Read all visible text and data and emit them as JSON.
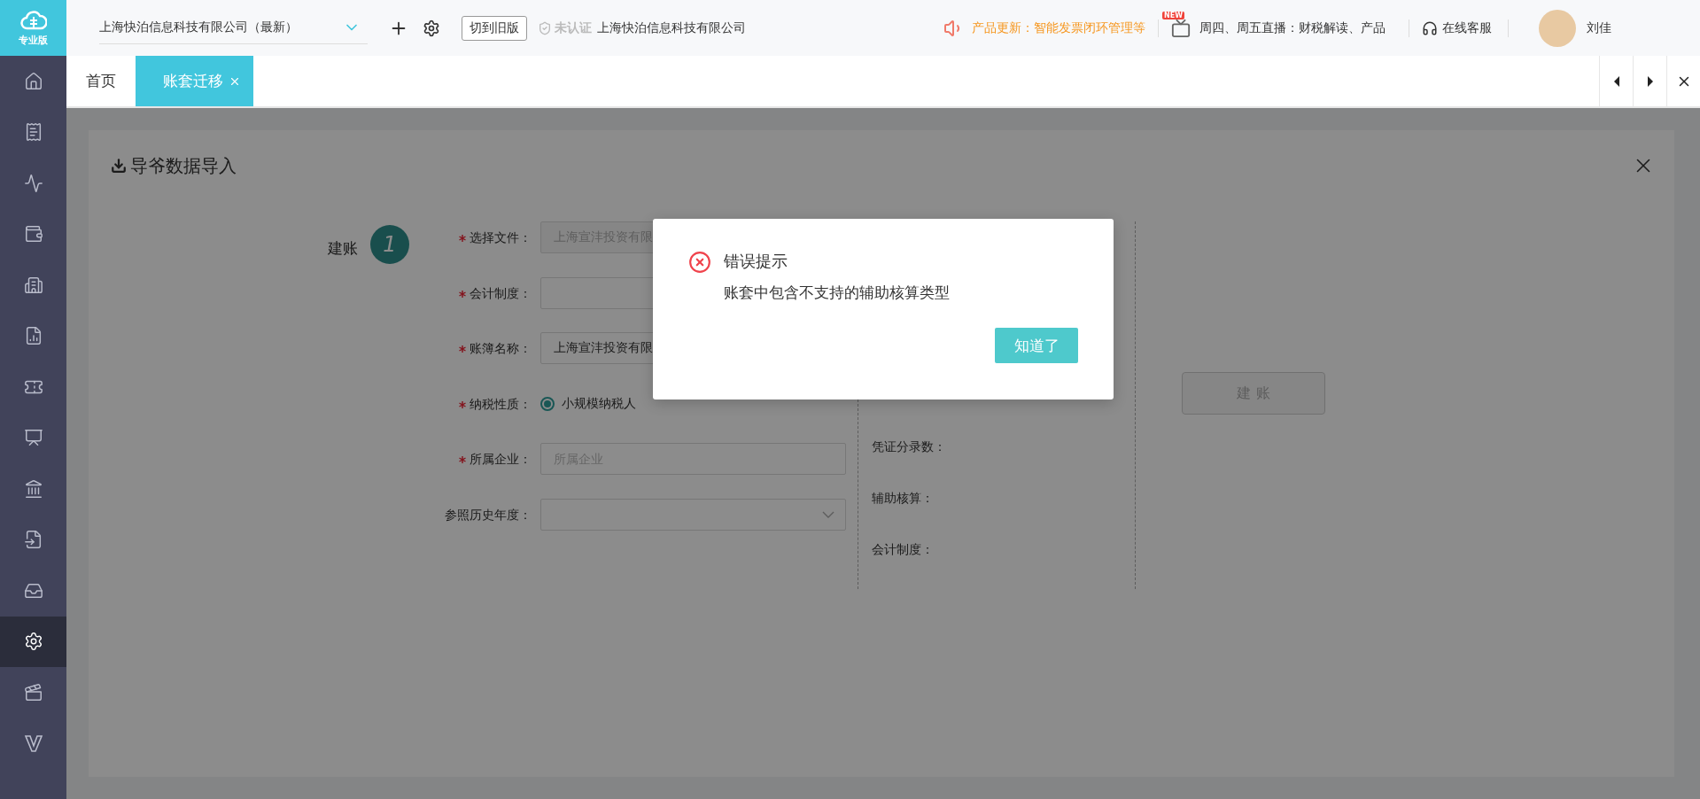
{
  "sidebar": {
    "logo_label": "专业版",
    "items": [
      {
        "selected": false
      },
      {
        "selected": false
      },
      {
        "selected": false
      },
      {
        "selected": false
      },
      {
        "selected": false
      },
      {
        "selected": false
      },
      {
        "selected": false
      },
      {
        "selected": false
      },
      {
        "selected": false
      },
      {
        "selected": false
      },
      {
        "selected": false
      },
      {
        "selected": true
      },
      {
        "selected": false
      },
      {
        "selected": false
      }
    ]
  },
  "header": {
    "company": "上海快泊信息科技有限公司（最新）",
    "switch_button": "切到旧版",
    "verify_status": "未认证",
    "verified_company": "上海快泊信息科技有限公司",
    "notice": "产品更新：智能发票闭环管理等",
    "live_badge": "NEW",
    "live_text": "周四、周五直播：财税解读、产品",
    "support": "在线客服",
    "user": "刘佳"
  },
  "tabs": [
    {
      "label": "首页",
      "selected": false,
      "closable": false
    },
    {
      "label": "账套迁移",
      "selected": true,
      "closable": true
    }
  ],
  "page": {
    "title": "导爷数据导入",
    "step": {
      "label": "建账",
      "number": "1"
    },
    "fields": [
      {
        "kind": "input",
        "label": "选择文件：",
        "required": true,
        "value": "上海宣沣投资有限",
        "disabled": true
      },
      {
        "kind": "input",
        "label": "会计制度：",
        "required": true
      },
      {
        "kind": "input",
        "label": "账簿名称：",
        "required": true,
        "value": "上海宣沣投资有限",
        "disabled": false
      },
      {
        "kind": "radio",
        "label": "纳税性质：",
        "required": true,
        "options": [
          {
            "label": "小规模纳税人",
            "selected": true
          }
        ]
      },
      {
        "kind": "input",
        "label": "所属企业：",
        "required": true,
        "placeholder": "所属企业"
      },
      {
        "kind": "select",
        "label": "参照历史年度：",
        "required": false
      }
    ],
    "summary_labels": [
      "凭证分录数：",
      "辅助核算：",
      "会计制度："
    ],
    "build_button": {
      "label": "建 账",
      "disabled": true
    }
  },
  "dialog": {
    "title": "错误提示",
    "message": "账套中包含不支持的辅助核算类型",
    "button": "知道了"
  }
}
